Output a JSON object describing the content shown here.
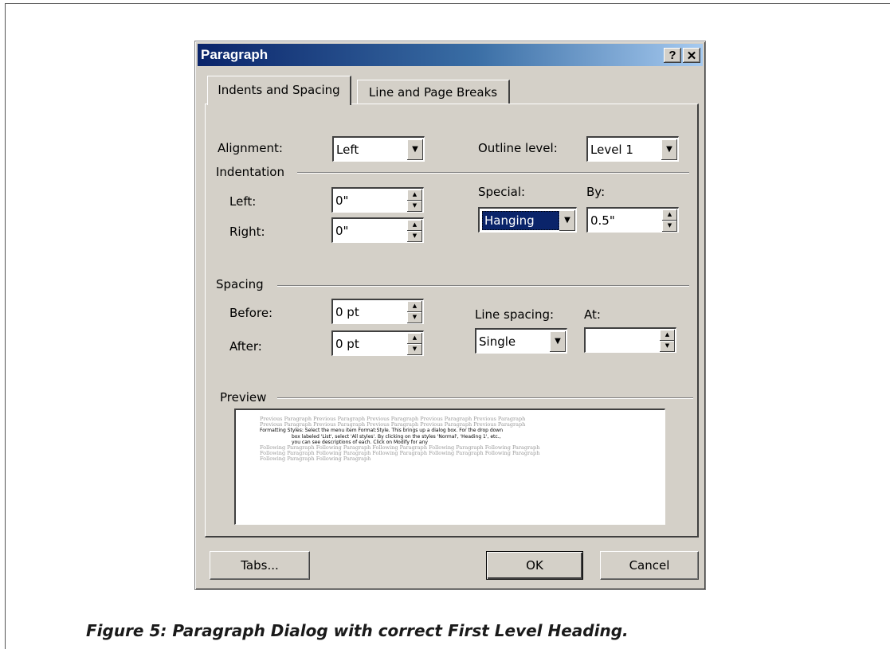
{
  "dialog": {
    "title": "Paragraph",
    "help_button": "?",
    "close_button": "✕",
    "tabs": [
      {
        "label": "Indents and Spacing",
        "active": true
      },
      {
        "label": "Line and Page Breaks",
        "active": false
      }
    ]
  },
  "general": {
    "alignment_label": "Alignment:",
    "alignment_value": "Left",
    "outline_label": "Outline level:",
    "outline_value": "Level 1"
  },
  "indentation": {
    "section_label": "Indentation",
    "left_label": "Left:",
    "left_value": "0\"",
    "right_label": "Right:",
    "right_value": "0\"",
    "special_label": "Special:",
    "special_value": "Hanging",
    "by_label": "By:",
    "by_value": "0.5\""
  },
  "spacing": {
    "section_label": "Spacing",
    "before_label": "Before:",
    "before_value": "0 pt",
    "after_label": "After:",
    "after_value": "0 pt",
    "line_spacing_label": "Line spacing:",
    "line_spacing_value": "Single",
    "at_label": "At:",
    "at_value": ""
  },
  "preview": {
    "section_label": "Preview",
    "previous_lines": [
      "Previous Paragraph Previous Paragraph Previous Paragraph Previous Paragraph Previous Paragraph",
      "Previous Paragraph Previous Paragraph Previous Paragraph Previous Paragraph Previous Paragraph"
    ],
    "main_line_1": "Formatting Styles: Select the menu item Format:Style. This brings up a dialog box. For the drop down",
    "main_line_2": "box labeled 'List', select 'All styles'. By clicking on the styles 'Normal', 'Heading 1', etc.,",
    "main_line_3": "you can see descriptions of each. Click on Modify for any",
    "following_lines": [
      "Following Paragraph Following Paragraph Following Paragraph Following Paragraph Following Paragraph",
      "Following Paragraph Following Paragraph Following Paragraph Following Paragraph Following Paragraph",
      "Following Paragraph Following Paragraph"
    ]
  },
  "buttons": {
    "tabs": "Tabs...",
    "ok": "OK",
    "cancel": "Cancel"
  },
  "caption": "Figure 5: Paragraph Dialog with correct First Level Heading.",
  "colors": {
    "dialog_face": "#d4d0c8",
    "titlebar_start": "#0a246a",
    "titlebar_end": "#a6caf0",
    "selection": "#0a246a"
  }
}
